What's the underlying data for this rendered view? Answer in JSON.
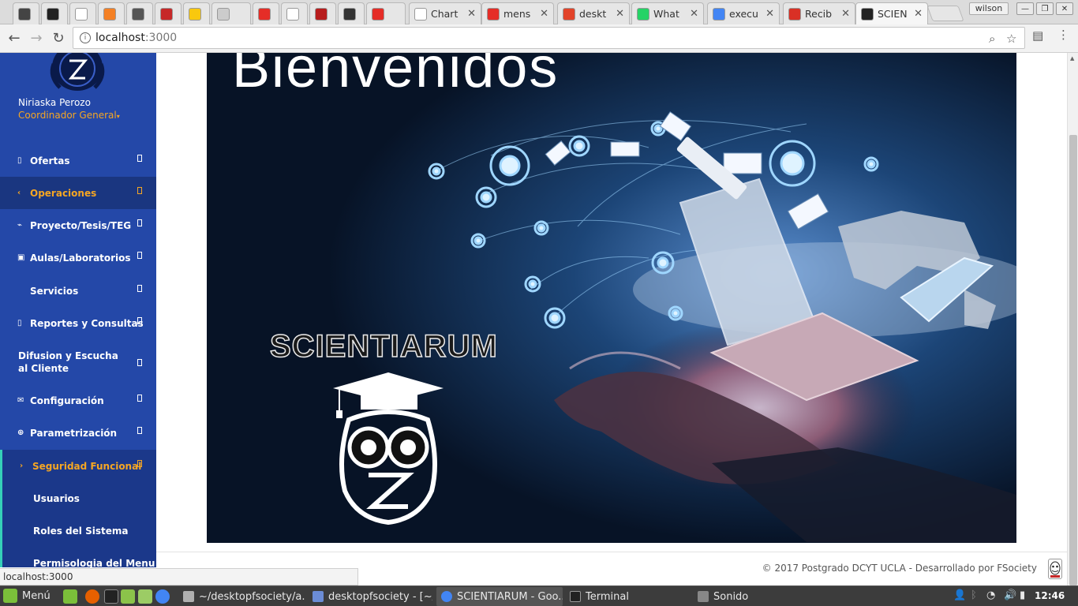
{
  "browser": {
    "tabs": [
      {
        "title": "",
        "fav_color": "#444444"
      },
      {
        "title": "",
        "fav_color": "#222222"
      },
      {
        "title": "",
        "fav_color": "#ffffff"
      },
      {
        "title": "",
        "fav_color": "#f48024"
      },
      {
        "title": "",
        "fav_color": "#555555"
      },
      {
        "title": "",
        "fav_color": "#c62828"
      },
      {
        "title": "",
        "fav_color": "#f9c80e"
      },
      {
        "title": "",
        "fav_color": "#cccccc"
      },
      {
        "title": "",
        "fav_color": "#e52d27"
      },
      {
        "title": "",
        "fav_color": "#ffffff"
      },
      {
        "title": "",
        "fav_color": "#b71c1c"
      },
      {
        "title": "",
        "fav_color": "#333333"
      },
      {
        "title": "",
        "fav_color": "#e52d27"
      },
      {
        "title": "Chart",
        "fav_color": "#ffffff"
      },
      {
        "title": "mens",
        "fav_color": "#e52d27"
      },
      {
        "title": "deskt",
        "fav_color": "#e24329"
      },
      {
        "title": "What",
        "fav_color": "#25d366"
      },
      {
        "title": "execu",
        "fav_color": "#4285f4"
      },
      {
        "title": "Recib",
        "fav_color": "#d93025"
      },
      {
        "title": "SCIEN",
        "fav_color": "#222222"
      }
    ],
    "profile_name": "wilson",
    "url_host": "localhost",
    "url_port": ":3000"
  },
  "sidebar": {
    "user_name": "Niriaska Perozo",
    "user_role": "Coordinador General",
    "items": [
      {
        "label": "Ofertas",
        "icon": "▯"
      },
      {
        "label": "Operaciones",
        "icon": "‹"
      },
      {
        "label": "Proyecto/Tesis/TEG",
        "icon": "⌁"
      },
      {
        "label": "Aulas/Laboratorios",
        "icon": "▣"
      },
      {
        "label": "Servicios",
        "icon": ""
      },
      {
        "label": "Reportes y Consultas",
        "icon": "▯"
      },
      {
        "label": "Difusion y Escucha al Cliente",
        "icon": ""
      },
      {
        "label": "Configuración",
        "icon": "✉"
      },
      {
        "label": "Parametrización",
        "icon": "⊕"
      },
      {
        "label": "Seguridad Funcional",
        "icon": "›"
      }
    ],
    "subitems": [
      {
        "label": "Usuarios"
      },
      {
        "label": "Roles del Sistema"
      },
      {
        "label": "Permisologia del Menu"
      }
    ]
  },
  "hero": {
    "title": "Bienvenidos",
    "brand": "SCIENTIARUM"
  },
  "footer": {
    "text": "© 2017 Postgrado DCYT UCLA - Desarrollado por FSociety"
  },
  "status_bubble": "localhost:3000",
  "taskbar": {
    "menu_label": "Menú",
    "windows": [
      {
        "label": "~/desktopfsociety/a...",
        "icon_color": "#b0b0b0"
      },
      {
        "label": "desktopfsociety - [~/...",
        "icon_color": "#6b8cd6"
      },
      {
        "label": "SCIENTIARUM - Goo...",
        "icon_color": "#4285f4"
      },
      {
        "label": "Terminal",
        "icon_color": "#222222"
      },
      {
        "label": "Sonido",
        "icon_color": "#888888"
      }
    ],
    "clock": "12:46"
  },
  "colors": {
    "sidebar_bg": "#2448a8",
    "accent_orange": "#f5a623",
    "accent_teal": "#35d0b8"
  }
}
